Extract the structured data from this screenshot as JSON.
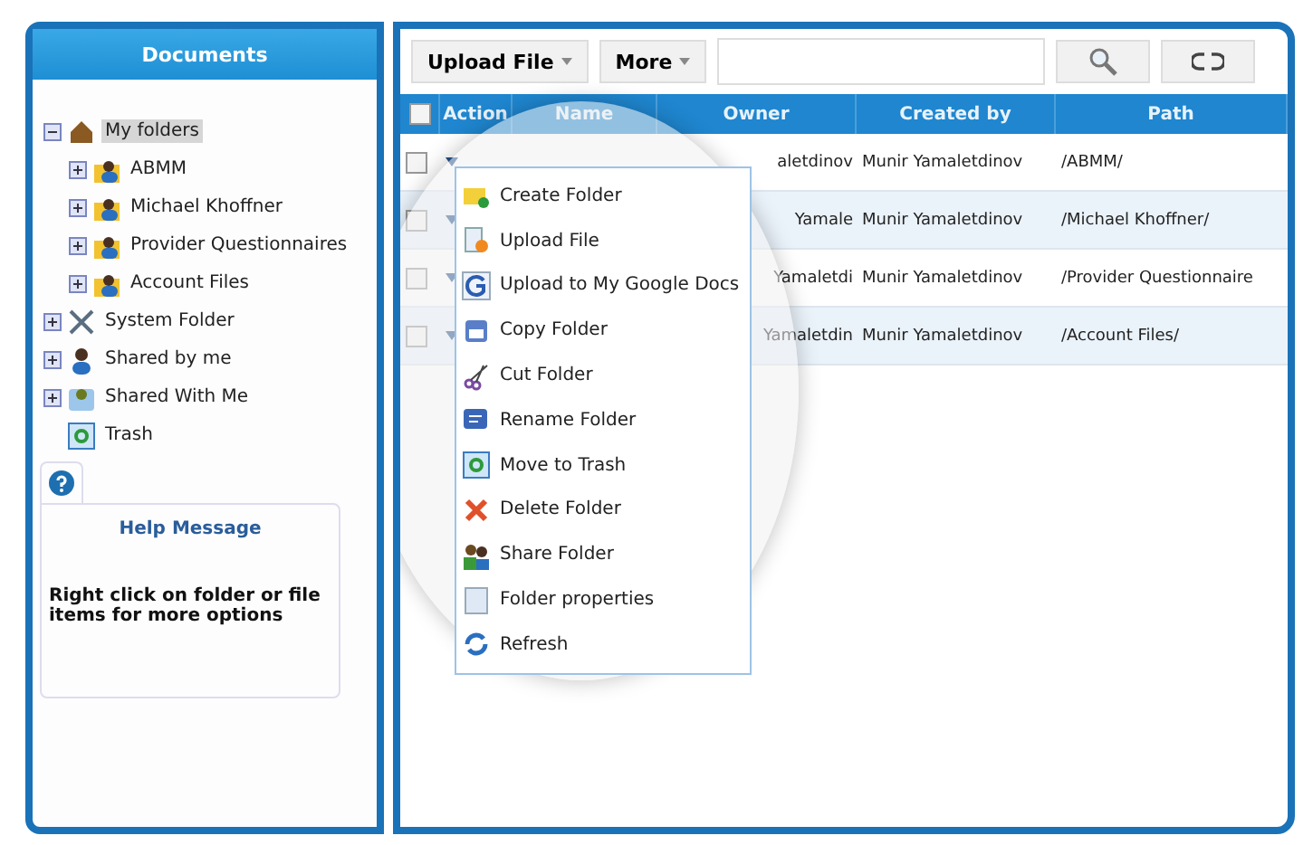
{
  "sidebar": {
    "title": "Documents",
    "tree": [
      {
        "label": "My folders",
        "expanded": true,
        "selected": true,
        "children": [
          {
            "label": "ABMM",
            "expanded": false,
            "selected": false
          },
          {
            "label": "Michael Khoffner",
            "expanded": false,
            "selected": false
          },
          {
            "label": "Provider Questionnaires",
            "expanded": false,
            "selected": false
          },
          {
            "label": "Account Files",
            "expanded": false,
            "selected": false
          }
        ]
      },
      {
        "label": "System Folder",
        "expanded": false,
        "selected": false
      },
      {
        "label": "Shared by me",
        "expanded": false,
        "selected": false
      },
      {
        "label": "Shared With Me",
        "expanded": false,
        "selected": false
      },
      {
        "label": "Trash",
        "selected": false
      }
    ],
    "help": {
      "title": "Help Message",
      "text": "Right click on folder or file items for more options"
    }
  },
  "toolbar": {
    "buttons": [
      "Upload File",
      "More"
    ]
  },
  "table": {
    "select_all_checked": false,
    "columns": [
      "Action",
      "Name",
      "Owner",
      "Created by",
      "Path"
    ],
    "rows": [
      {
        "checked": false,
        "owner": "aletdinov",
        "created_by": "Munir Yamaletdinov",
        "path": "/ABMM/"
      },
      {
        "checked": false,
        "owner": "Yamale",
        "created_by": "Munir Yamaletdinov",
        "path": "/Michael Khoffner/"
      },
      {
        "checked": false,
        "owner": "Yamaletdi",
        "created_by": "Munir Yamaletdinov",
        "path": "/Provider Questionnaire"
      },
      {
        "checked": false,
        "owner": "Yamaletdin",
        "created_by": "Munir Yamaletdinov",
        "path": "/Account Files/"
      }
    ]
  },
  "context_menu": [
    "Create Folder",
    "Upload File",
    "Upload to My Google Docs",
    "Copy Folder",
    "Cut Folder",
    "Rename Folder",
    "Move to Trash",
    "Delete Folder",
    "Share Folder",
    "Folder properties",
    "Refresh"
  ]
}
